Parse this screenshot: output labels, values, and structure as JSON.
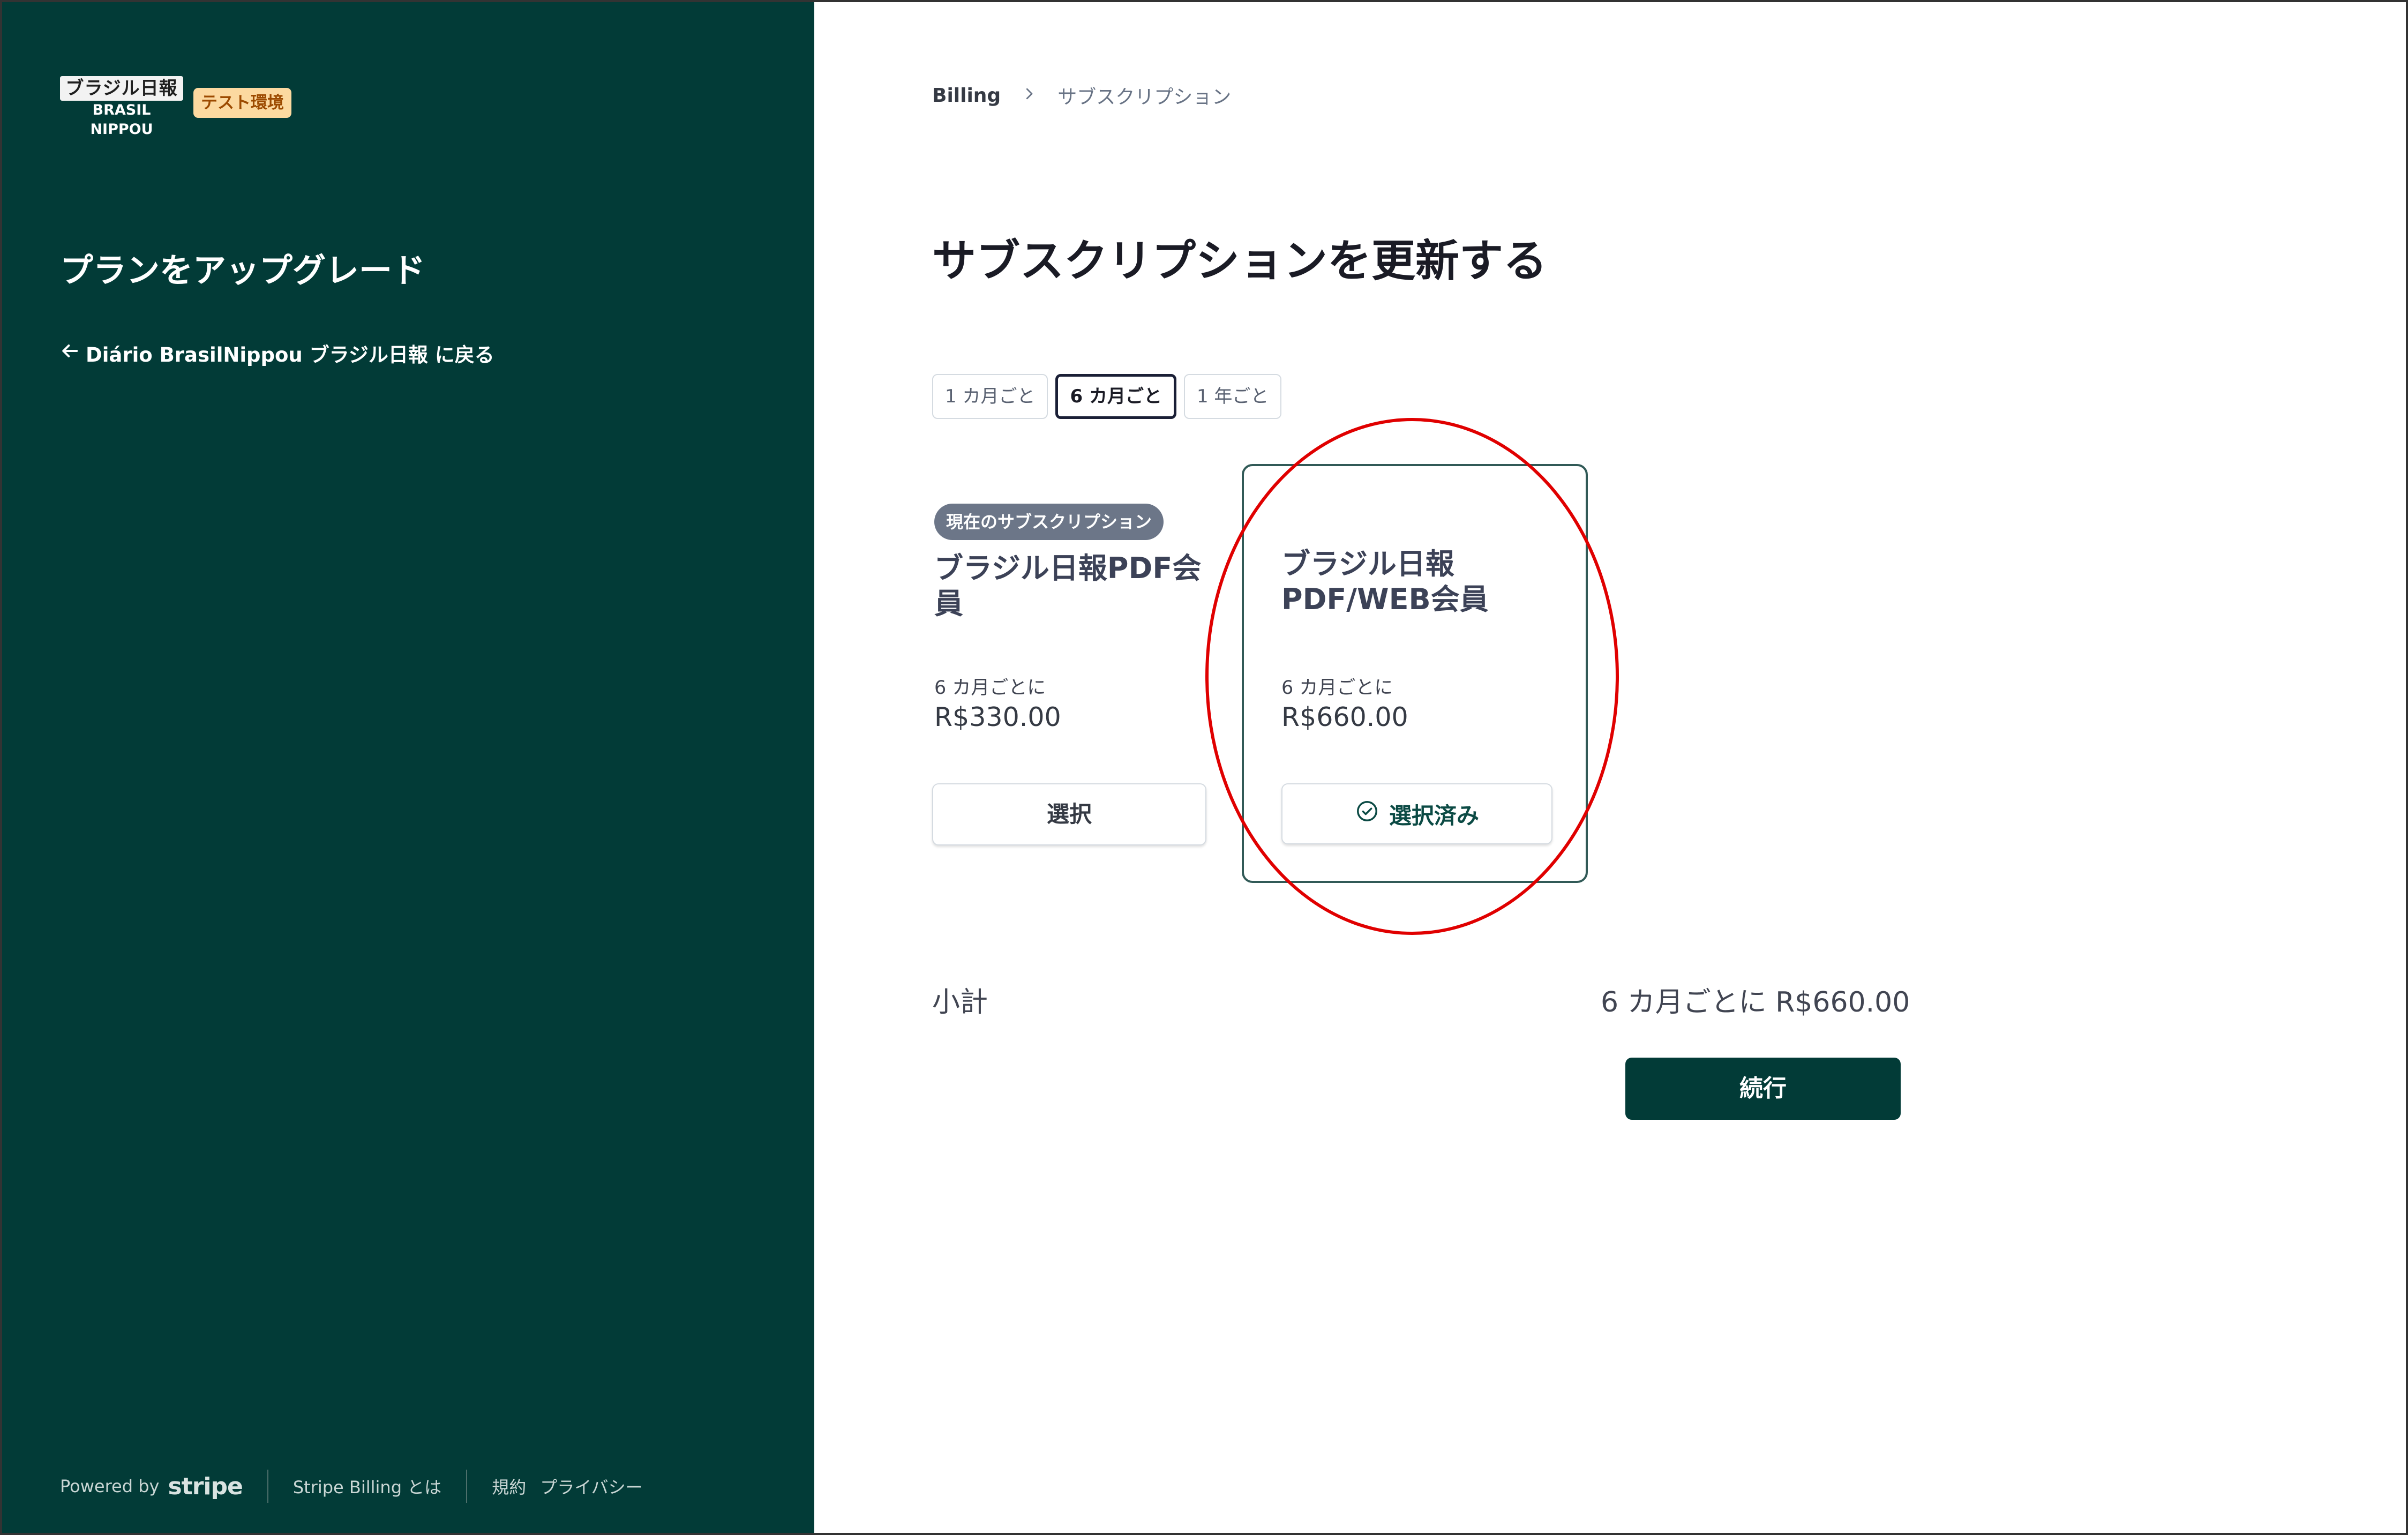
{
  "brand": {
    "logo_line1": "ブラジル日報",
    "logo_line2": "BRASIL NIPPOU",
    "env_badge": "テスト環境"
  },
  "sidebar": {
    "title": "プランをアップグレード",
    "back_link": "Diário BrasilNippou ブラジル日報 に戻る",
    "footer": {
      "powered_by": "Powered by",
      "stripe": "stripe",
      "about": "Stripe Billing とは",
      "terms": "規約",
      "privacy": "プライバシー"
    }
  },
  "breadcrumb": {
    "root": "Billing",
    "current": "サブスクリプション"
  },
  "main": {
    "title": "サブスクリプションを更新する",
    "tabs": [
      {
        "label": "1 カ月ごと",
        "active": false
      },
      {
        "label": "6 カ月ごと",
        "active": true
      },
      {
        "label": "1 年ごと",
        "active": false
      }
    ],
    "plans": [
      {
        "badge": "現在のサブスクリプション",
        "name": "ブラジル日報PDF会員",
        "interval": "6 カ月ごとに",
        "price": "R$330.00",
        "button": "選択"
      },
      {
        "name": "ブラジル日報 PDF/WEB会員",
        "interval": "6 カ月ごとに",
        "price": "R$660.00",
        "button": "選択済み"
      }
    ],
    "subtotal_label": "小計",
    "subtotal_value": "6 カ月ごとに R$660.00",
    "continue": "続行"
  },
  "colors": {
    "sidebar_bg": "#023b37",
    "accent": "#023b37",
    "annotation": "#e00000",
    "badge_bg": "#fcd9a0"
  }
}
